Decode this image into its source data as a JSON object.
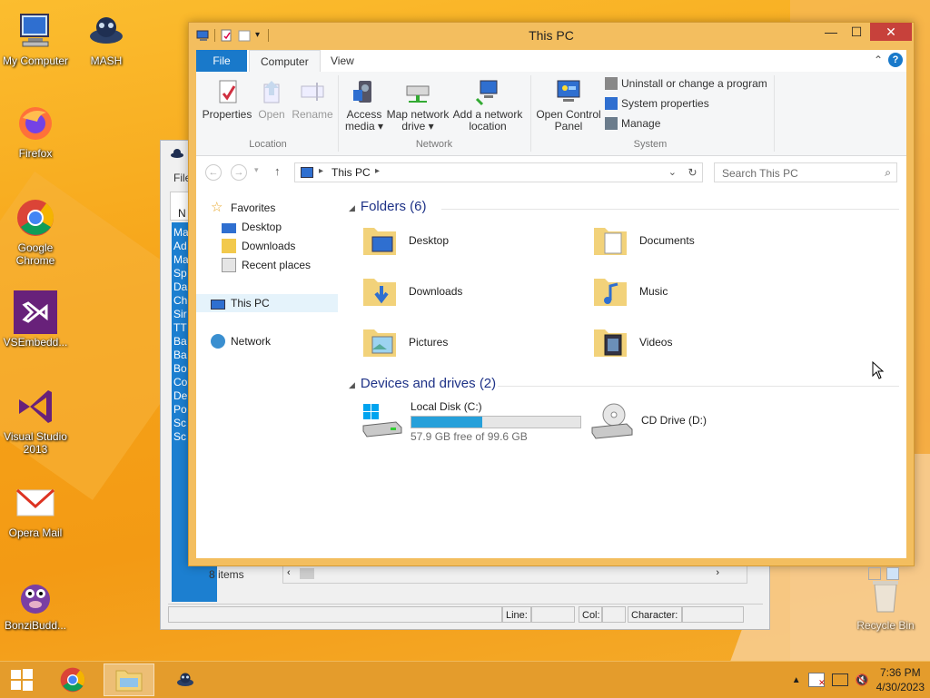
{
  "desktop": {
    "icons": [
      {
        "label": "My Computer",
        "icon": "computer-icon"
      },
      {
        "label": "MASH",
        "icon": "mash-icon"
      },
      {
        "label": "Firefox",
        "icon": "firefox-icon"
      },
      {
        "label": "Google Chrome",
        "icon": "chrome-icon"
      },
      {
        "label": "VSEmbedd...",
        "icon": "visual-studio-icon"
      },
      {
        "label": "Visual Studio 2013",
        "icon": "visual-studio-icon"
      },
      {
        "label": "Opera  Mail",
        "icon": "mail-icon"
      },
      {
        "label": "BonziBudd...",
        "icon": "bonzi-icon"
      },
      {
        "label": "Recycle Bin",
        "icon": "recycle-bin-icon"
      }
    ]
  },
  "notepad": {
    "file_menu": "File",
    "menu_partial": "N",
    "list_items": [
      "Ma",
      "Ad",
      "Ma",
      "Sp",
      "Da",
      "Ch",
      "Sir",
      "TT",
      "Ba",
      "Ba",
      "Bo",
      "Co",
      "De",
      "Po",
      "Sc",
      "Sc"
    ],
    "status": {
      "line": "Line:",
      "col": "Col:",
      "character": "Character:"
    }
  },
  "explorer": {
    "title": "This PC",
    "tabs": {
      "file": "File",
      "computer": "Computer",
      "view": "View"
    },
    "ribbon": {
      "properties": "Properties",
      "open": "Open",
      "rename": "Rename",
      "location_group": "Location",
      "access_media_1": "Access",
      "access_media_2": "media ▾",
      "map_drive_1": "Map network",
      "map_drive_2": "drive ▾",
      "add_location_1": "Add a network",
      "add_location_2": "location",
      "network_group": "Network",
      "control_panel_1": "Open Control",
      "control_panel_2": "Panel",
      "uninstall": "Uninstall or change a program",
      "system_properties": "System properties",
      "manage": "Manage",
      "system_group": "System"
    },
    "address": {
      "location": "This PC",
      "search_placeholder": "Search This PC"
    },
    "nav": {
      "favorites": "Favorites",
      "desktop": "Desktop",
      "downloads": "Downloads",
      "recent": "Recent places",
      "this_pc": "This PC",
      "network": "Network"
    },
    "folders_header": "Folders (6)",
    "folders": [
      "Desktop",
      "Documents",
      "Downloads",
      "Music",
      "Pictures",
      "Videos"
    ],
    "devices_header": "Devices and drives (2)",
    "drives": [
      {
        "name": "Local Disk (C:)",
        "free": "57.9 GB free of 99.6 GB",
        "used_fraction": 0.42
      },
      {
        "name": "CD Drive (D:)"
      }
    ],
    "status": "8 items"
  },
  "taskbar": {
    "time": "7:36 PM",
    "date": "4/30/2023"
  }
}
